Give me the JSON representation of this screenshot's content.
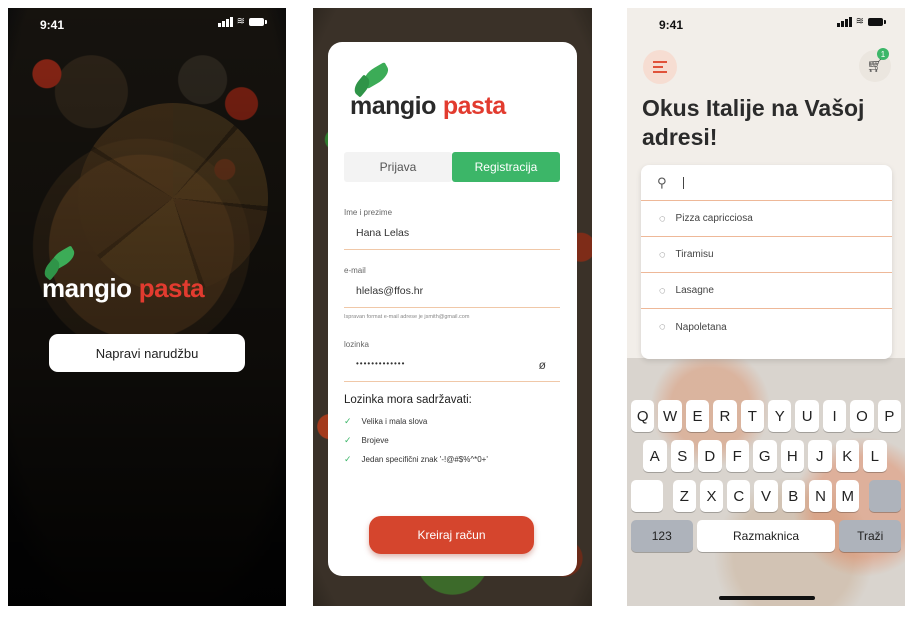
{
  "screen_splash": {
    "status_time": "9:41",
    "logo_word_a": "mangio",
    "logo_word_b": "pasta",
    "order_button": "Napravi narudžbu"
  },
  "screen_register": {
    "logo_word_a": "mangio",
    "logo_word_b": "pasta",
    "tabs": {
      "login": "Prijava",
      "register": "Registracija"
    },
    "fields": {
      "name_label": "Ime i prezime",
      "name_value": "Hana Lelas",
      "email_label": "e-mail",
      "email_value": "hlelas@ffos.hr",
      "email_hint": "Ispravan format e-mail adrese je jsmith@gmail.com",
      "password_label": "lozinka",
      "password_value": "•••••••••••••"
    },
    "rules_title": "Lozinka mora sadržavati:",
    "rules": [
      "Velika i mala slova",
      "Brojeve",
      "Jedan specifični znak '-!@#$%^*0+'"
    ],
    "create_button": "Kreiraj račun",
    "accent_green": "#3cb668",
    "accent_red": "#d5452d"
  },
  "screen_search": {
    "status_time": "9:41",
    "cart_count": "1",
    "headline": "Okus Italije na Vašoj adresi!",
    "search_value": "",
    "suggestions": [
      "Pizza capricciosa",
      "Tiramisu",
      "Lasagne",
      "Napoletana"
    ],
    "keyboard": {
      "row1": [
        "Q",
        "W",
        "E",
        "R",
        "T",
        "Y",
        "U",
        "I",
        "O",
        "P"
      ],
      "row2": [
        "A",
        "S",
        "D",
        "F",
        "G",
        "H",
        "J",
        "K",
        "L"
      ],
      "row3": [
        "Z",
        "X",
        "C",
        "V",
        "B",
        "N",
        "M"
      ],
      "numbers_key": "123",
      "space_key": "Razmaknica",
      "search_key": "Traži"
    }
  }
}
